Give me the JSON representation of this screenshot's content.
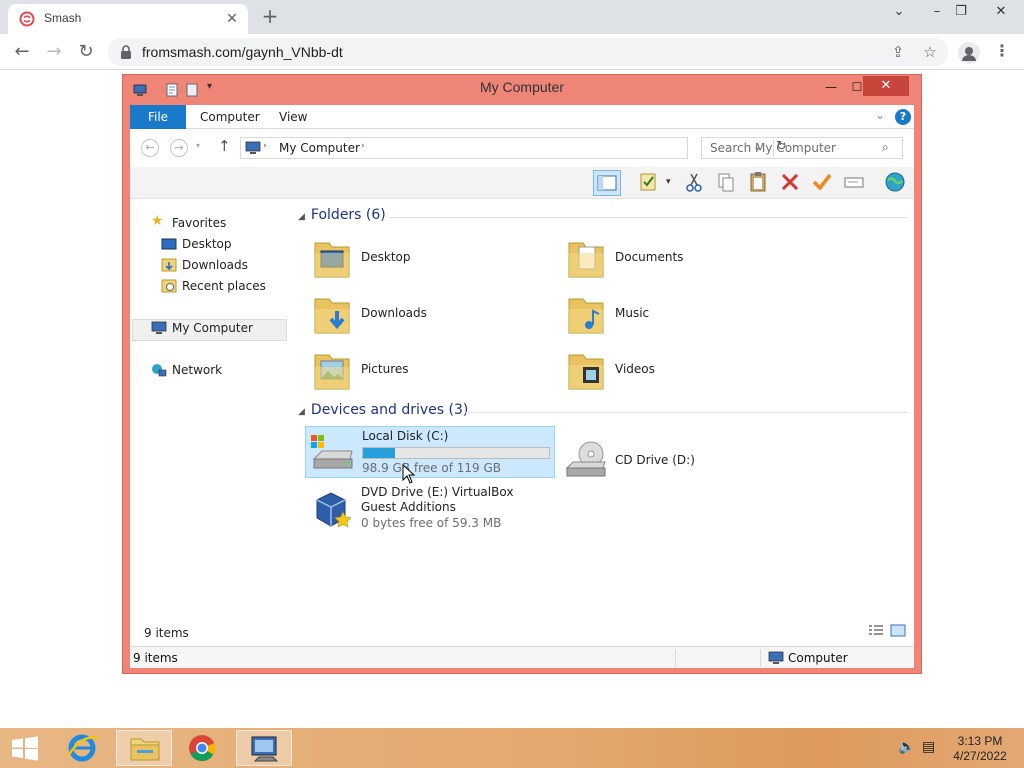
{
  "browser": {
    "tab_title": "Smash",
    "url": "fromsmash.com/gaynh_VNbb-dt",
    "window_controls": [
      "chevron-down-icon",
      "minimize-icon",
      "restore-icon",
      "close-icon"
    ]
  },
  "explorer": {
    "title": "My Computer",
    "ribbon_tabs": [
      "File",
      "Computer",
      "View"
    ],
    "address": "My Computer",
    "search_placeholder": "Search My Computer",
    "help": "?",
    "nav": {
      "favorites": "Favorites",
      "desktop": "Desktop",
      "downloads": "Downloads",
      "recent": "Recent places",
      "computer": "My Computer",
      "network": "Network"
    },
    "folders_header": "Folders (6)",
    "folders": [
      "Desktop",
      "Documents",
      "Downloads",
      "Music",
      "Pictures",
      "Videos"
    ],
    "devices_header": "Devices and drives (3)",
    "drives": {
      "c_name": "Local Disk (C:)",
      "c_free": "98.9 GB free of 119 GB",
      "c_used_fraction": 0.17,
      "d_name": "CD Drive (D:)",
      "e_name": "DVD Drive (E:) VirtualBox Guest Additions",
      "e_free": "0 bytes free of 59.3 MB"
    },
    "items_count_inner": "9 items",
    "status_left": "9 items",
    "status_right": "Computer"
  },
  "taskbar": {
    "time": "3:13 PM",
    "date": "4/27/2022"
  },
  "colors": {
    "window_frame": "#ef8577",
    "accent_blue": "#1979ca",
    "selection": "#cce8ff",
    "taskbar": "#e3a86e"
  }
}
